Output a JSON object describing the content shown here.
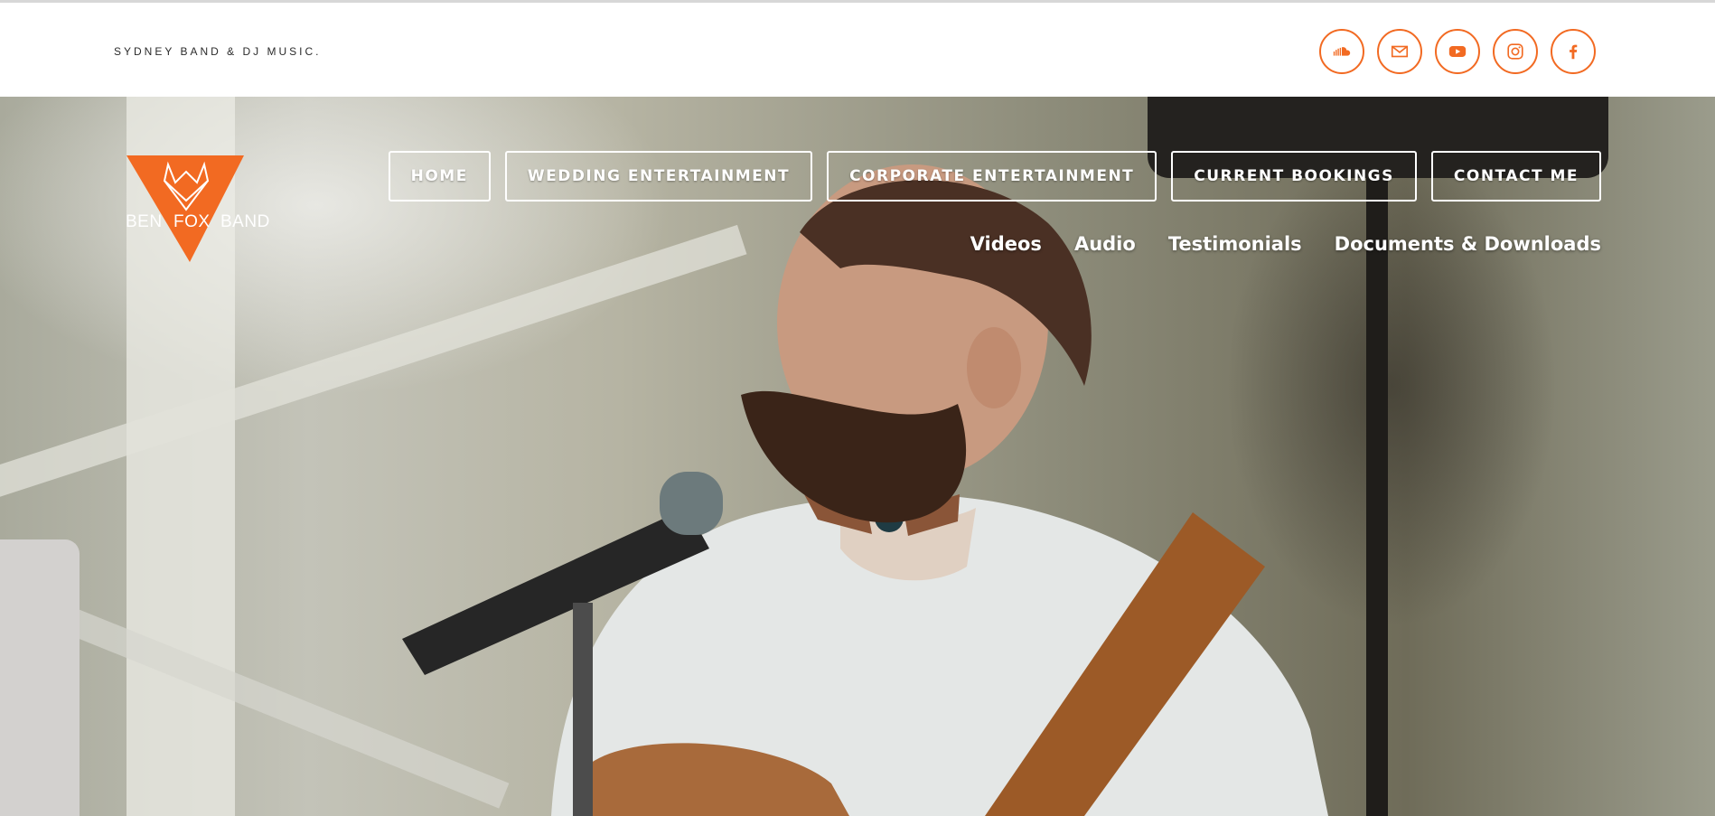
{
  "header": {
    "tagline": "SYDNEY BAND & DJ MUSIC.",
    "social": [
      {
        "icon": "soundcloud-icon"
      },
      {
        "icon": "email-icon"
      },
      {
        "icon": "youtube-icon"
      },
      {
        "icon": "instagram-icon"
      },
      {
        "icon": "facebook-icon"
      }
    ],
    "accent_color": "#f26a22"
  },
  "logo": {
    "words": [
      "BEN",
      "FOX",
      "BAND"
    ],
    "color": "#f26a22"
  },
  "nav": {
    "primary": [
      {
        "label": "HOME"
      },
      {
        "label": "WEDDING ENTERTAINMENT"
      },
      {
        "label": "CORPORATE ENTERTAINMENT"
      },
      {
        "label": "CURRENT BOOKINGS"
      },
      {
        "label": "CONTACT ME"
      }
    ],
    "secondary": [
      {
        "label": "Videos"
      },
      {
        "label": "Audio"
      },
      {
        "label": "Testimonials"
      },
      {
        "label": "Documents & Downloads"
      }
    ]
  }
}
